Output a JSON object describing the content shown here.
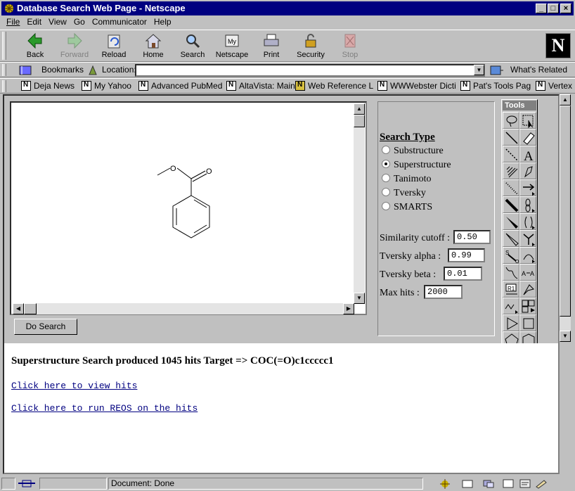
{
  "window": {
    "title": "Database Search Web Page - Netscape",
    "controls": [
      "_",
      "□",
      "×"
    ]
  },
  "menu": [
    "File",
    "Edit",
    "View",
    "Go",
    "Communicator",
    "Help"
  ],
  "nav_buttons": [
    {
      "label": "Back",
      "icon": "back-arrow-icon",
      "enabled": true
    },
    {
      "label": "Forward",
      "icon": "forward-arrow-icon",
      "enabled": false
    },
    {
      "label": "Reload",
      "icon": "reload-icon",
      "enabled": true
    },
    {
      "label": "Home",
      "icon": "home-icon",
      "enabled": true
    },
    {
      "label": "Search",
      "icon": "search-icon",
      "enabled": true
    },
    {
      "label": "Netscape",
      "icon": "netscape-icon",
      "enabled": true
    },
    {
      "label": "Print",
      "icon": "print-icon",
      "enabled": true
    },
    {
      "label": "Security",
      "icon": "lock-icon",
      "enabled": true
    },
    {
      "label": "Stop",
      "icon": "stop-icon",
      "enabled": false
    }
  ],
  "logo": "N",
  "location": {
    "bookmarks_label": "Bookmarks",
    "location_label": "Location:",
    "value": "",
    "whats_related": "What's Related"
  },
  "personal_links": [
    "Deja News",
    "My Yahoo",
    "Advanced PubMed",
    "AltaVista: Main",
    "Web Reference L",
    "WWWebster Dicti",
    "Pat's Tools Pag",
    "Vertex"
  ],
  "search_form": {
    "search_type_label": "Search Type",
    "options": [
      {
        "label": "Substructure",
        "selected": false
      },
      {
        "label": "Superstructure",
        "selected": true
      },
      {
        "label": "Tanimoto",
        "selected": false
      },
      {
        "label": "Tversky",
        "selected": false
      },
      {
        "label": "SMARTS",
        "selected": false
      }
    ],
    "params": [
      {
        "label": "Similarity cutoff :",
        "value": "0.50"
      },
      {
        "label": "Tversky alpha :",
        "value": "0.99"
      },
      {
        "label": "Tversky beta :",
        "value": "0.01"
      },
      {
        "label": "Max hits :",
        "value": "2000"
      }
    ],
    "do_search": "Do Search",
    "tools_title": "Tools",
    "molecule_atom_label": "O"
  },
  "results": {
    "summary": "Superstructure Search produced 1045 hits Target => COC(=O)c1ccccc1",
    "view_hits_link": "Click here to view hits",
    "reos_link": "Click here to run REOS on the hits"
  },
  "status": {
    "text": "Document: Done"
  },
  "colors": {
    "titlebar": "#000080",
    "chrome": "#c0c0c0",
    "link": "#000080"
  }
}
